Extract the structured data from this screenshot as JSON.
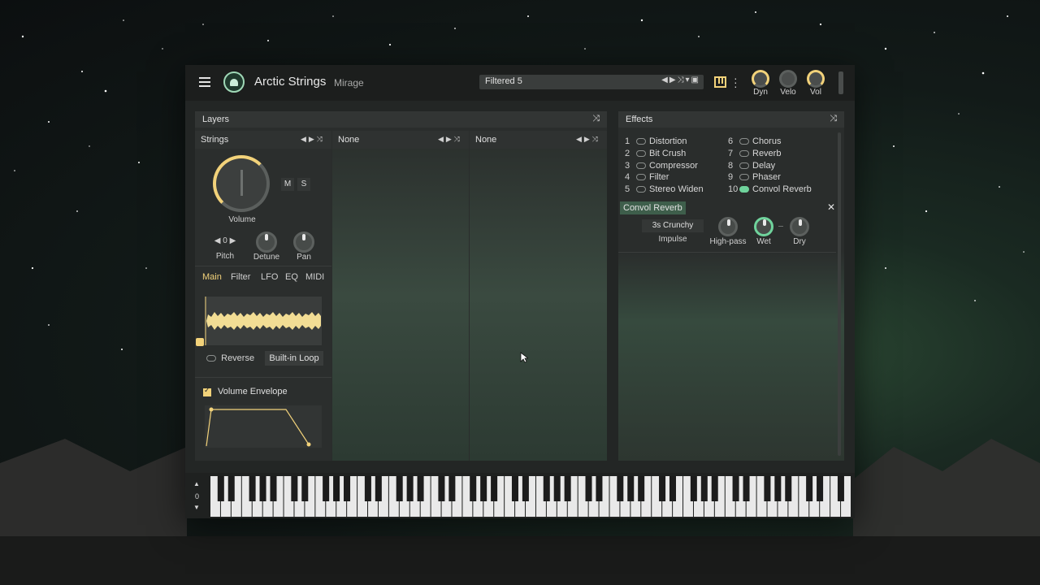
{
  "header": {
    "title": "Arctic Strings",
    "subtitle": "Mirage",
    "preset": "Filtered 5",
    "knobs": [
      {
        "label": "Dyn"
      },
      {
        "label": "Velo"
      },
      {
        "label": "Vol"
      }
    ]
  },
  "layers": {
    "title": "Layers",
    "columns": [
      {
        "name": "Strings"
      },
      {
        "name": "None"
      },
      {
        "name": "None"
      }
    ],
    "volume_label": "Volume",
    "mute_label": "M",
    "solo_label": "S",
    "pitch_value": "0",
    "pitch_label": "Pitch",
    "detune_label": "Detune",
    "pan_label": "Pan",
    "tabs": [
      "Main",
      "Filter",
      "LFO",
      "EQ",
      "MIDI"
    ],
    "active_tab": "Main",
    "reverse_label": "Reverse",
    "loop_label": "Built-in Loop",
    "envelope_label": "Volume Envelope"
  },
  "effects": {
    "title": "Effects",
    "items": [
      {
        "num": "1",
        "name": "Distortion",
        "on": false
      },
      {
        "num": "2",
        "name": "Bit Crush",
        "on": false
      },
      {
        "num": "3",
        "name": "Compressor",
        "on": false
      },
      {
        "num": "4",
        "name": "Filter",
        "on": false
      },
      {
        "num": "5",
        "name": "Stereo Widen",
        "on": false
      },
      {
        "num": "6",
        "name": "Chorus",
        "on": false
      },
      {
        "num": "7",
        "name": "Reverb",
        "on": false
      },
      {
        "num": "8",
        "name": "Delay",
        "on": false
      },
      {
        "num": "9",
        "name": "Phaser",
        "on": false
      },
      {
        "num": "10",
        "name": "Convol Reverb",
        "on": true
      }
    ],
    "selected": "Convol Reverb",
    "impulse_value": "3s Crunchy",
    "impulse_label": "Impulse",
    "knobs": [
      "High-pass",
      "Wet",
      "Dry"
    ]
  },
  "keyboard": {
    "octave": "0"
  },
  "colors": {
    "accent": "#f2d27a",
    "active_green": "#6fd39c",
    "panel": "#2a2d2c"
  }
}
